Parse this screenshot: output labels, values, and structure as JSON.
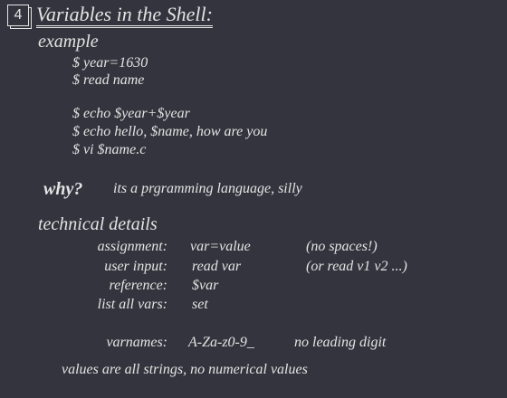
{
  "slide": {
    "number": "4",
    "title": "Variables in the Shell:",
    "example_heading": "example",
    "example_lines": [
      "$ year=1630",
      "$ read name",
      "$ echo $year+$year",
      "$ echo hello, $name, how are you",
      "$ vi $name.c"
    ],
    "why_label": "why?",
    "why_answer": "its a prgramming language, silly",
    "details_heading": "technical details",
    "details": [
      {
        "label": "assignment:",
        "value": "var=value",
        "note": "(no spaces!)"
      },
      {
        "label": "user input:",
        "value": "read var",
        "note": "(or read v1 v2 ...)"
      },
      {
        "label": "reference:",
        "value": "$var",
        "note": ""
      },
      {
        "label": "list all vars:",
        "value": "set",
        "note": ""
      }
    ],
    "varnames_label": "varnames:",
    "varnames_value": "A-Za-z0-9_",
    "varnames_note": "no leading digit",
    "footer": "values are all strings, no numerical values"
  }
}
